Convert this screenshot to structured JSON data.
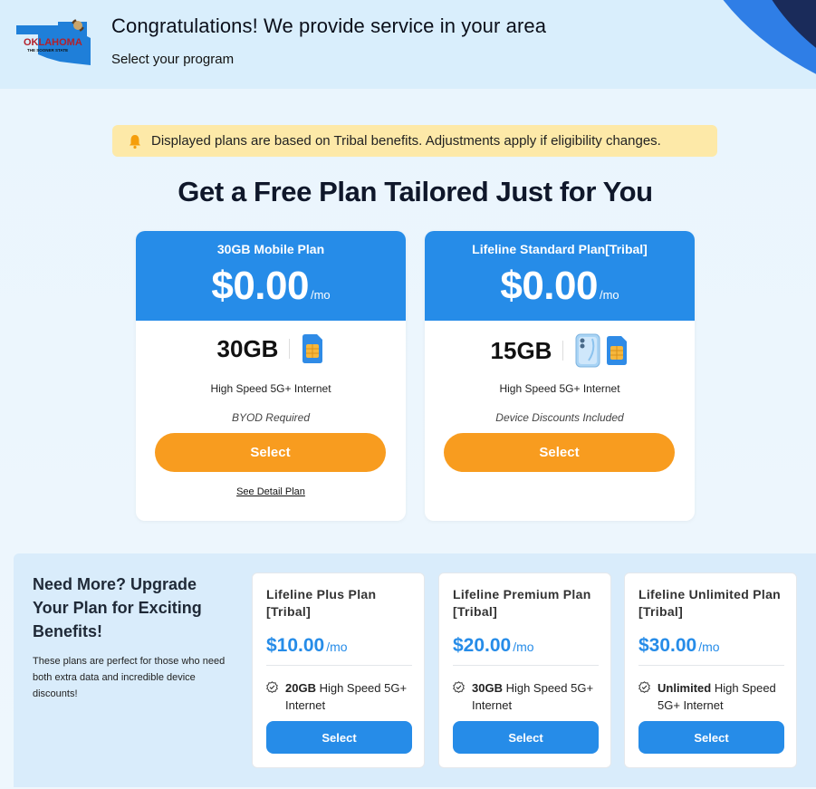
{
  "header": {
    "title": "Congratulations! We provide service in your area",
    "subtitle": "Select your program",
    "logo": {
      "line1": "OKLAHOMA",
      "line2": "THE SOONER STATE"
    }
  },
  "notice": {
    "text": "Displayed plans are based on Tribal benefits. Adjustments apply if eligibility changes."
  },
  "main_heading": "Get a Free Plan Tailored Just for You",
  "plans": [
    {
      "name": "30GB Mobile Plan",
      "price": "$0.00",
      "per": "/mo",
      "data": "30GB",
      "feature": "High Speed 5G+ Internet",
      "note": "BYOD Required",
      "select_label": "Select",
      "detail_label": "See Detail Plan"
    },
    {
      "name": "Lifeline Standard Plan[Tribal]",
      "price": "$0.00",
      "per": "/mo",
      "data": "15GB",
      "feature": "High Speed 5G+ Internet",
      "note": "Device Discounts Included",
      "select_label": "Select"
    }
  ],
  "upgrade": {
    "title": "Need More? Upgrade Your Plan for Exciting Benefits!",
    "description": "These plans are perfect for those who need both extra data and incredible device discounts!",
    "plans": [
      {
        "name": "Lifeline Plus Plan [Tribal]",
        "price": "$10.00",
        "per": "/mo",
        "feature_bold": "20GB",
        "feature_rest": " High Speed 5G+ Internet",
        "select_label": "Select"
      },
      {
        "name": "Lifeline Premium Plan [Tribal]",
        "price": "$20.00",
        "per": "/mo",
        "feature_bold": "30GB",
        "feature_rest": " High Speed 5G+ Internet",
        "select_label": "Select"
      },
      {
        "name": "Lifeline Unlimited Plan [Tribal]",
        "price": "$30.00",
        "per": "/mo",
        "feature_bold": "Unlimited",
        "feature_rest": " High Speed 5G+ Internet",
        "select_label": "Select"
      }
    ]
  },
  "colors": {
    "primary_blue": "#268ce8",
    "orange": "#f89c1f",
    "notice_bg": "#fde9a8",
    "header_bg": "#d9eefc"
  }
}
